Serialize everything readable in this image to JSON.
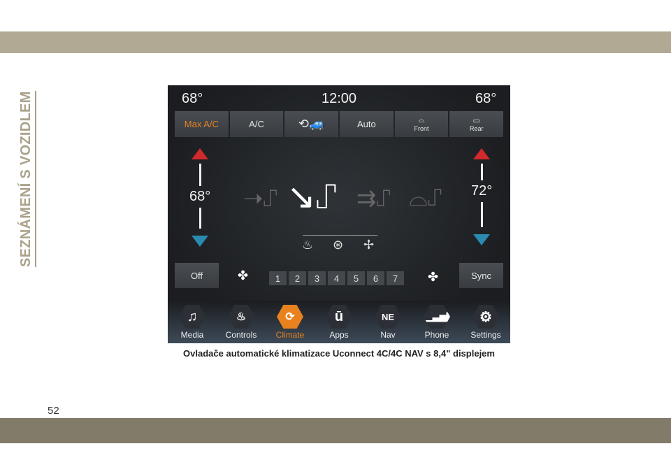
{
  "page": {
    "section_title": "SEZNÁMENÍ S VOZIDLEM",
    "page_number": "52",
    "caption": "Ovladače automatické klimatizace Uconnect 4C/4C NAV s 8,4\" displejem",
    "band_color": "#b1a994"
  },
  "screen": {
    "left_temp_top": "68°",
    "clock": "12:00",
    "right_temp_top": "68°",
    "buttons": [
      {
        "label": "Max A/C",
        "active": true,
        "color": "#e8821e"
      },
      {
        "label": "A/C"
      },
      {
        "label": "",
        "icon": "recirculation-car-icon"
      },
      {
        "label": "Auto"
      },
      {
        "label": "Front",
        "icon": "front-defrost-icon"
      },
      {
        "label": "Rear",
        "icon": "rear-defrost-icon"
      }
    ],
    "driver_temp": "68°",
    "passenger_temp": "72°",
    "modes": [
      "panel-mode-icon",
      "floor-mode-icon",
      "panel-floor-mode-icon",
      "defrost-floor-mode-icon"
    ],
    "seat_controls": [
      "heated-seat-icon",
      "heated-steering-wheel-icon",
      "ventilated-seat-icon"
    ],
    "off_label": "Off",
    "sync_label": "Sync",
    "fan_speeds": [
      "1",
      "2",
      "3",
      "4",
      "5",
      "6",
      "7"
    ],
    "nav": [
      {
        "label": "Media",
        "icon": "music-note-icon"
      },
      {
        "label": "Controls",
        "icon": "controls-seat-icon"
      },
      {
        "label": "Climate",
        "icon": "climate-icon",
        "active": true
      },
      {
        "label": "Apps",
        "icon": "apps-icon",
        "glyph": "ū"
      },
      {
        "label": "Nav",
        "icon": "compass-icon",
        "glyph": "NE"
      },
      {
        "label": "Phone",
        "icon": "phone-signal-icon"
      },
      {
        "label": "Settings",
        "icon": "gear-icon"
      }
    ],
    "accent_color": "#e8821e"
  }
}
